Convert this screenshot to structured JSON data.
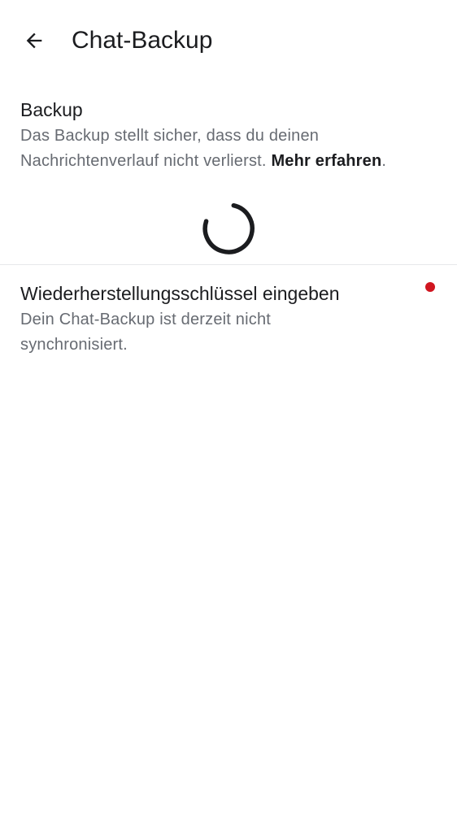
{
  "header": {
    "back_icon": "arrow-left-icon",
    "title": "Chat-Backup"
  },
  "backup": {
    "title": "Backup",
    "description": "Das Backup stellt sicher, dass du deinen Nachrichtenverlauf nicht verlierst. ",
    "link_label": "Mehr erfahren",
    "link_suffix": ".",
    "loading_icon": "loading-spinner-icon"
  },
  "restore": {
    "title": "Wiederherstellungsschlüssel eingeben",
    "description": "Dein Chat-Backup ist derzeit nicht synchronisiert.",
    "indicator_icon": "red-dot-icon",
    "indicator_color": "#d0151f"
  },
  "colors": {
    "text_primary": "#1b1c1f",
    "text_secondary": "#676b72",
    "divider": "#e7e8ea"
  }
}
